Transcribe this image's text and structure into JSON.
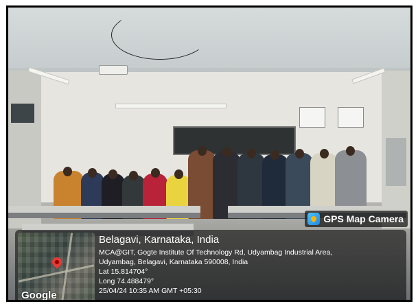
{
  "gps_camera": {
    "badge_label": "GPS Map Camera",
    "location_title": "Belagavi, Karnataka, India",
    "address_line_1": "MCA@GIT, Gogte Institute Of Technology Rd, Udyambag Industrial Area,",
    "address_line_2": "Udyambag, Belagavi, Karnataka 590008, India",
    "latitude": "Lat 15.814704°",
    "longitude": "Long 74.488479°",
    "timestamp": "25/04/24 10:35 AM GMT +05:30",
    "map_brand": "Google"
  },
  "colors": {
    "overlay_bg": "#0f0f0f",
    "pin": "#e53935",
    "badge_icon": "#1e88e5"
  },
  "icons": [
    "gps-map-camera-icon",
    "map-pin-icon"
  ]
}
